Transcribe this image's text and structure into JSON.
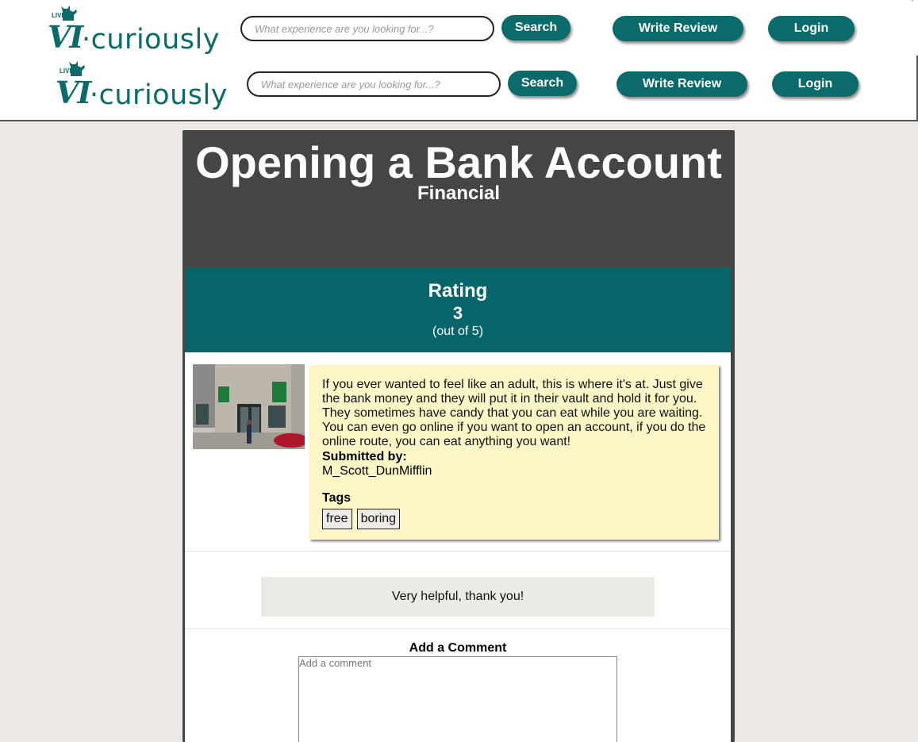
{
  "headers": [
    {
      "logo": {
        "badge": "LIVE",
        "mark": "VI",
        "word": "·curiously"
      },
      "search": {
        "placeholder": "What experience are you looking for...?",
        "button": "Search"
      },
      "write_review": "Write Review",
      "login": "Login"
    },
    {
      "logo": {
        "badge": "LIVE",
        "mark": "VI",
        "word": "·curiously"
      },
      "search": {
        "placeholder": "What experience are you looking for...?",
        "button": "Search"
      },
      "write_review": "Write Review",
      "login": "Login"
    }
  ],
  "experience": {
    "title": "Opening a Bank Account",
    "category": "Financial"
  },
  "rating": {
    "label": "Rating",
    "value": "3",
    "scale": "(out of 5)"
  },
  "review": {
    "photo_alt": "bank storefront",
    "text": "If you ever wanted to feel like an adult, this is where it's at. Just give the bank money and they will put it in their vault and hold it for you. They sometimes have candy that you can eat while you are waiting. You can even go online if you want to open an account, if you do the online route, you can eat anything you want!",
    "submitted_label": "Submitted by:",
    "submitted_user": "M_Scott_DunMifflin",
    "tags_label": "Tags",
    "tags": [
      "free",
      "boring"
    ]
  },
  "comments": [
    {
      "text": "Very helpful, thank you!"
    }
  ],
  "add_comment": {
    "label": "Add a Comment",
    "placeholder": "Add a comment"
  },
  "colors": {
    "brand": "#0b6b6b",
    "rating_band": "#06646b",
    "card_header": "#454545",
    "review_bg": "#fcf6c7",
    "page_bg": "#ece9e4"
  }
}
